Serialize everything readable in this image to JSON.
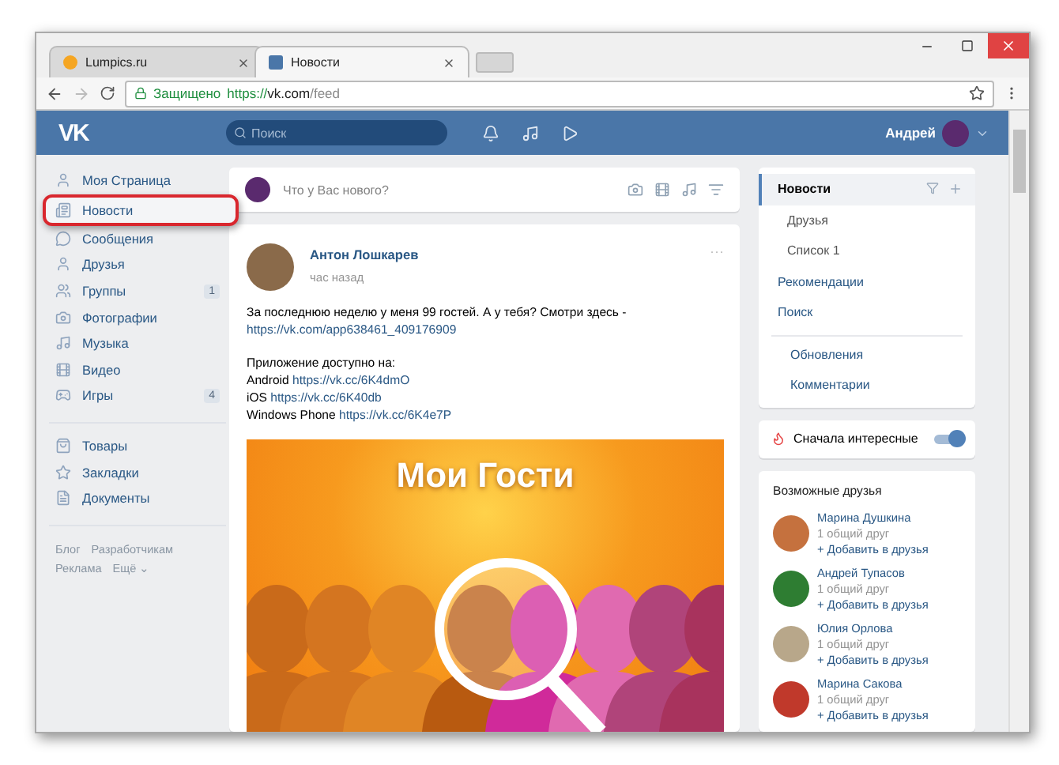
{
  "browser": {
    "tabs": [
      {
        "label": "Lumpics.ru",
        "selected": false
      },
      {
        "label": "Новости",
        "selected": true
      }
    ],
    "address": {
      "security": "Защищено",
      "scheme": "https://",
      "host": "vk.com",
      "path": "/feed"
    }
  },
  "header": {
    "logo": "VK",
    "search": {
      "placeholder": "Поиск"
    },
    "user": "Андрей"
  },
  "sidebar": {
    "groups": [
      [
        {
          "label": "Моя Страница",
          "highlighted": false
        },
        {
          "label": "Новости",
          "highlighted": true
        },
        {
          "label": "Сообщения",
          "highlighted": false
        },
        {
          "label": "Друзья",
          "highlighted": false
        },
        {
          "label": "Группы",
          "highlighted": false,
          "badge": "1"
        },
        {
          "label": "Фотографии",
          "highlighted": false
        },
        {
          "label": "Музыка",
          "highlighted": false
        },
        {
          "label": "Видео",
          "highlighted": false
        },
        {
          "label": "Игры",
          "highlighted": false,
          "badge": "4"
        }
      ],
      [
        {
          "label": "Товары",
          "highlighted": false
        },
        {
          "label": "Закладки",
          "highlighted": false
        },
        {
          "label": "Документы",
          "highlighted": false
        }
      ]
    ],
    "footer": [
      "Блог",
      "Разработчикам",
      "Реклама",
      "Ещё ⌄"
    ]
  },
  "composer": {
    "placeholder": "Что у Вас нового?"
  },
  "post": {
    "author": "Антон Лошкарев",
    "time": "час назад",
    "more": "···",
    "paragraphs": [
      [
        {
          "text": "За последнюю неделю у меня 99 гостей. А у тебя? Смотри здесь -"
        },
        {
          "link": "https://vk.com/app638461_409176909"
        }
      ],
      [
        {
          "text": "Приложение доступно на:"
        },
        {
          "text": "Android",
          "link": "https://vk.cc/6K4dmO"
        },
        {
          "text": "iOS",
          "link": "https://vk.cc/6K40db"
        },
        {
          "text": "Windows Phone",
          "link": "https://vk.cc/6K4e7P"
        }
      ]
    ],
    "image": {
      "title": "Мои Гости"
    }
  },
  "feed_menu": {
    "groups": [
      [
        {
          "label": "Новости",
          "selected": true,
          "children": [
            {
              "label": "Друзья",
              "selected": false
            },
            {
              "label": "Список 1",
              "selected": false
            }
          ]
        },
        {
          "label": "Рекомендации",
          "selected": false
        },
        {
          "label": "Поиск",
          "selected": false
        }
      ],
      [
        {
          "label": "Обновления",
          "selected": false
        },
        {
          "label": "Комментарии",
          "selected": false
        }
      ]
    ]
  },
  "interesting_first": {
    "label": "Сначала интересные",
    "on": true
  },
  "possible_friends": {
    "title": "Возможные друзья",
    "friends": [
      {
        "name": "Марина Душкина",
        "mutual": "1 общий друг",
        "add": "+ Добавить в друзья"
      },
      {
        "name": "Андрей Тупасов",
        "mutual": "1 общий друг",
        "add": "+ Добавить в друзья"
      },
      {
        "name": "Юлия Орлова",
        "mutual": "1 общий друг",
        "add": "+ Добавить в друзья"
      },
      {
        "name": "Марина Сакова",
        "mutual": "1 общий друг",
        "add": "+ Добавить в друзья"
      }
    ]
  }
}
